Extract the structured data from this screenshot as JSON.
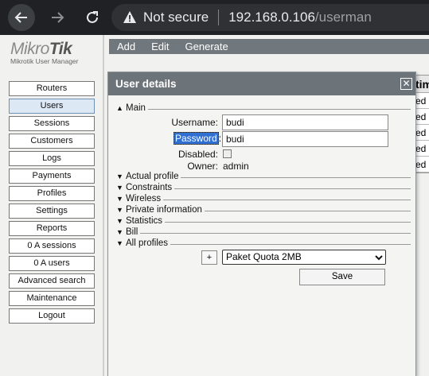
{
  "browser": {
    "security_label": "Not secure",
    "url_host": "192.168.0.106",
    "url_path": "/userman"
  },
  "logo": {
    "brand_light": "Mikro",
    "brand_bold": "Tik",
    "subtitle": "Mikrotik User Manager"
  },
  "sidebar": {
    "items": [
      {
        "label": "Routers"
      },
      {
        "label": "Users"
      },
      {
        "label": "Sessions"
      },
      {
        "label": "Customers"
      },
      {
        "label": "Logs"
      },
      {
        "label": "Payments"
      },
      {
        "label": "Profiles"
      },
      {
        "label": "Settings"
      },
      {
        "label": "Reports"
      },
      {
        "label": "0 A sessions"
      },
      {
        "label": "0 A users"
      },
      {
        "label": "Advanced search"
      },
      {
        "label": "Maintenance"
      },
      {
        "label": "Logout"
      }
    ],
    "active_index": 1
  },
  "toolbar": {
    "add": "Add",
    "edit": "Edit",
    "generate": "Generate"
  },
  "background_table": {
    "header": "tim",
    "cells": [
      "ed",
      "ed",
      "ed",
      "ed",
      "ed"
    ]
  },
  "dialog": {
    "title": "User details",
    "close_glyph": "✕",
    "sections": {
      "main": "Main",
      "actual_profile": "Actual profile",
      "constraints": "Constraints",
      "wireless": "Wireless",
      "private_information": "Private information",
      "statistics": "Statistics",
      "bill": "Bill",
      "all_profiles": "All profiles"
    },
    "fields": {
      "username_label": "Username:",
      "username_value": "budi",
      "password_label": "Password",
      "password_colon": ":",
      "password_value": "budi",
      "disabled_label": "Disabled:",
      "owner_label": "Owner:",
      "owner_value": "admin"
    },
    "profile_add": "+",
    "profile_selected": "Paket Quota 2MB",
    "save_label": "Save"
  },
  "colors": {
    "chrome_bg": "#202124",
    "toolbar_bg": "#71787d",
    "dialog_title_bg": "#6d7479",
    "selection_highlight": "#2f6fd1"
  }
}
